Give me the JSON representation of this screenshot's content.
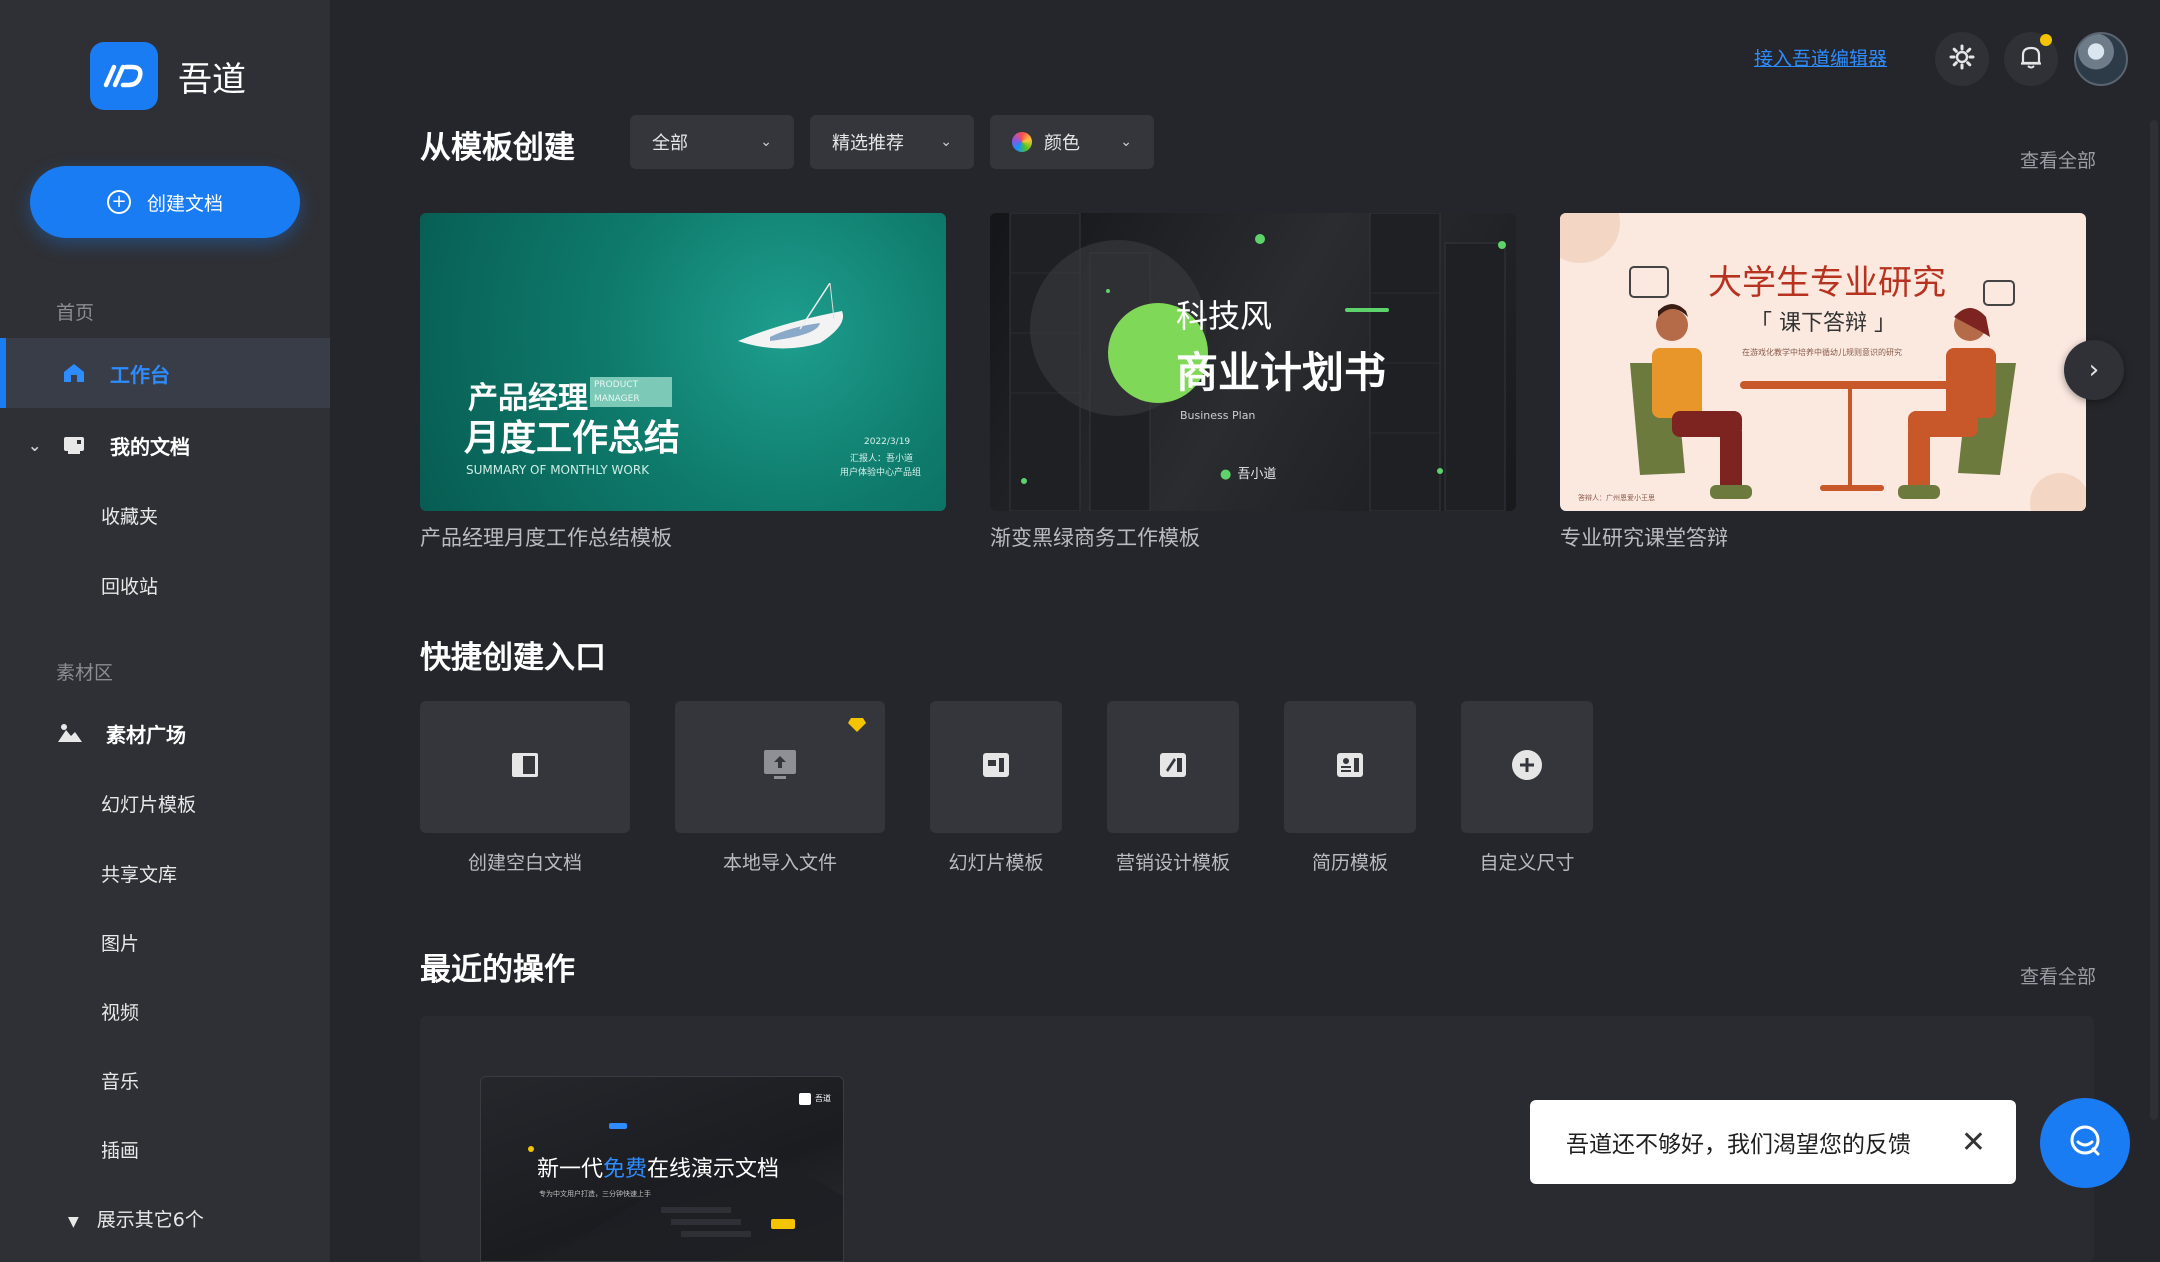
{
  "app": {
    "name": "吾道"
  },
  "sidebar": {
    "create_label": "创建文档",
    "section_home": "首页",
    "workbench": "工作台",
    "my_docs": "我的文档",
    "favorites": "收藏夹",
    "recycle": "回收站",
    "section_material": "素材区",
    "material_square": "素材广场",
    "subitems": [
      "幻灯片模板",
      "共享文库",
      "图片",
      "视频",
      "音乐",
      "插画"
    ],
    "show_more": "展示其它6个"
  },
  "topbar": {
    "link": "接入吾道编辑器"
  },
  "templates": {
    "title": "从模板创建",
    "view_all": "查看全部",
    "filters": [
      "全部",
      "精选推荐",
      "颜色"
    ],
    "cards": [
      {
        "caption": "产品经理月度工作总结模板",
        "title_line1": "产品经理",
        "title_line2": "月度工作总结",
        "tag": "PRODUCT MANAGER",
        "subtitle": "SUMMARY OF MONTHLY WORK",
        "date": "2022/3/19",
        "reporter": "汇报人：吾小道",
        "dept": "用户体验中心产品组"
      },
      {
        "caption": "渐变黑绿商务工作模板",
        "title_line1": "科技风",
        "title_line2": "商业计划书",
        "subtitle": "Business Plan",
        "author": "吾小道"
      },
      {
        "caption": "专业研究课堂答辩",
        "title_line1": "大学生专业研究",
        "title_line2": "「 课下答辩 」",
        "subtitle": "在游戏化教学中培养中循幼儿规则意识的研究",
        "footer": "答辩人：广州恩爱小王思"
      }
    ]
  },
  "quick": {
    "title": "快捷创建入口",
    "items": [
      "创建空白文档",
      "本地导入文件",
      "幻灯片模板",
      "营销设计模板",
      "简历模板",
      "自定义尺寸"
    ]
  },
  "recent": {
    "title": "最近的操作",
    "view_all": "查看全部",
    "card_text_a": "新一代",
    "card_text_b": "免费",
    "card_text_c": "在线演示文档",
    "card_sub": "专为中文用户打造，三分钟快速上手",
    "card_brand": "吾道"
  },
  "feedback": {
    "text": "吾道还不够好，我们渴望您的反馈",
    "close": "✕"
  },
  "colors": {
    "accent": "#1a7cf2",
    "bg": "#25262b",
    "sidebar": "#2f3035",
    "notif": "#f5c400"
  }
}
